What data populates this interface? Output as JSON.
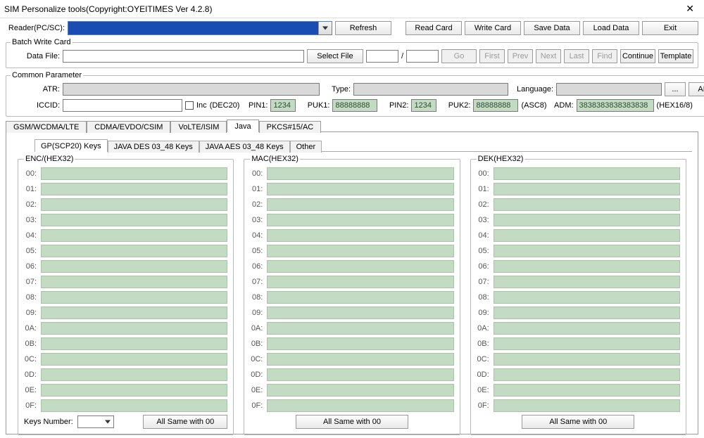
{
  "title": "SIM Personalize tools(Copyright:OYEITIMES Ver 4.2.8)",
  "reader_label": "Reader(PC/SC):",
  "toolbar": {
    "refresh": "Refresh",
    "read_card": "Read Card",
    "write_card": "Write Card",
    "save_data": "Save Data",
    "load_data": "Load Data",
    "exit": "Exit"
  },
  "batch": {
    "legend": "Batch Write Card",
    "data_file": "Data File:",
    "select_file": "Select File",
    "go": "Go",
    "first": "First",
    "prev": "Prev",
    "next": "Next",
    "last": "Last",
    "find": "Find",
    "continue": "Continue",
    "template": "Template",
    "slash": "/",
    "page_current": "",
    "page_total": ""
  },
  "common": {
    "legend": "Common Parameter",
    "atr": "ATR:",
    "type": "Type:",
    "language": "Language:",
    "adn": "ADN",
    "iccid": "ICCID:",
    "inc": "Inc",
    "dec20": "(DEC20)",
    "pin1": "PIN1:",
    "pin1_val": "1234",
    "puk1": "PUK1:",
    "puk1_val": "88888888",
    "pin2": "PIN2:",
    "pin2_val": "1234",
    "puk2": "PUK2:",
    "puk2_val": "88888888",
    "asc8": "(ASC8)",
    "adm": "ADM:",
    "adm_val": "3838383838383838",
    "hex168": "(HEX16/8)",
    "lang_btn": "..."
  },
  "tabs": {
    "main": [
      "GSM/WCDMA/LTE",
      "CDMA/EVDO/CSIM",
      "VoLTE/ISIM",
      "Java",
      "PKCS#15/AC"
    ],
    "main_active_index": 3,
    "keys": [
      "GP(SCP20) Keys",
      "JAVA DES 03_48 Keys",
      "JAVA AES 03_48 Keys",
      "Other"
    ],
    "keys_active_index": 0
  },
  "key_groups": {
    "enc": "ENC/(HEX32)",
    "mac": "MAC(HEX32)",
    "dek": "DEK(HEX32)",
    "row_idx": [
      "00:",
      "01:",
      "02:",
      "03:",
      "04:",
      "05:",
      "06:",
      "07:",
      "08:",
      "09:",
      "0A:",
      "0B:",
      "0C:",
      "0D:",
      "0E:",
      "0F:"
    ]
  },
  "foot": {
    "keys_number": "Keys Number:",
    "all_same": "All Same with 00"
  }
}
